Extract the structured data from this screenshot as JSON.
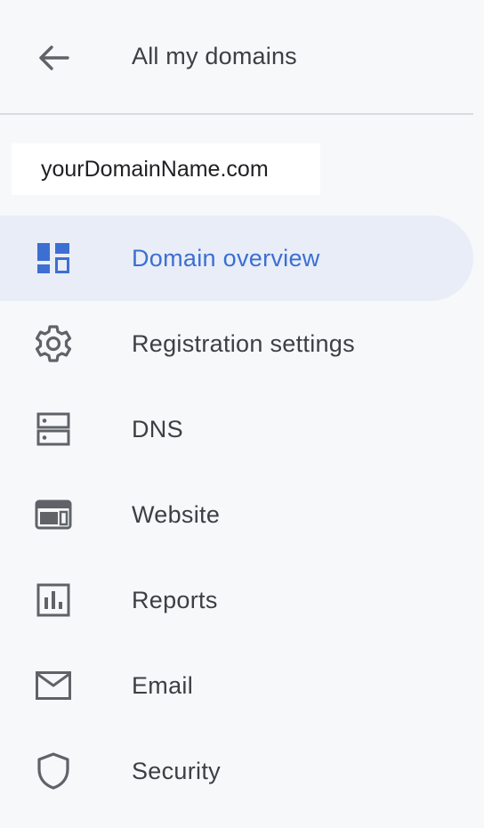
{
  "header": {
    "back_label": "All my domains"
  },
  "domain": {
    "name": "yourDomainName.com"
  },
  "nav": {
    "items": [
      {
        "label": "Domain overview",
        "icon": "dashboard-icon",
        "active": true
      },
      {
        "label": "Registration settings",
        "icon": "gear-icon",
        "active": false
      },
      {
        "label": "DNS",
        "icon": "dns-icon",
        "active": false
      },
      {
        "label": "Website",
        "icon": "website-icon",
        "active": false
      },
      {
        "label": "Reports",
        "icon": "reports-icon",
        "active": false
      },
      {
        "label": "Email",
        "icon": "email-icon",
        "active": false
      },
      {
        "label": "Security",
        "icon": "shield-icon",
        "active": false
      }
    ]
  },
  "colors": {
    "accent": "#3c6fd1",
    "active_bg": "#e8edf8",
    "text": "#3c4043",
    "background": "#f7f8fa"
  }
}
